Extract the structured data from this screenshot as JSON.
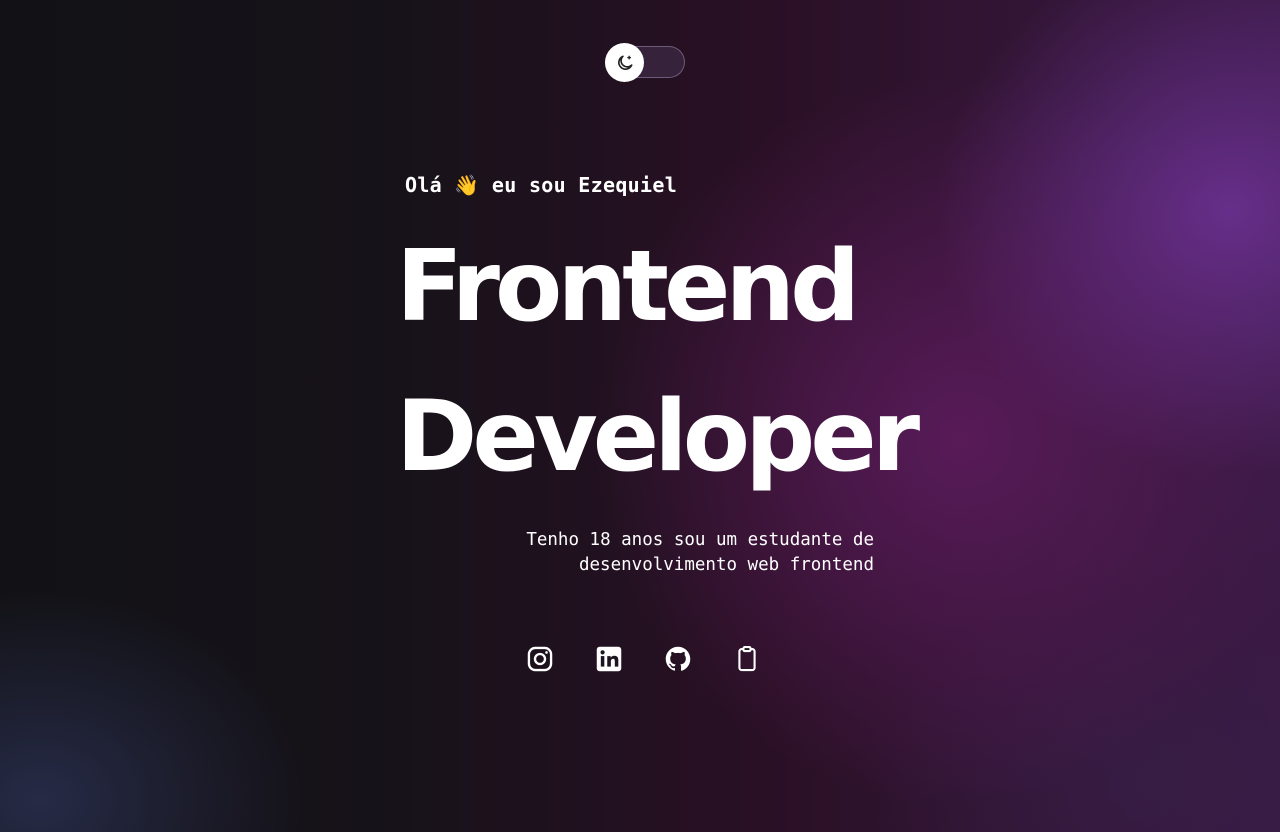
{
  "theme_toggle": {
    "icon": "moon-icon",
    "state": "dark"
  },
  "hero": {
    "greeting_prefix": "Olá",
    "greeting_emoji": "👋",
    "greeting_suffix": "eu sou Ezequiel",
    "title_line1": "Frontend",
    "title_line2": "Developer",
    "bio_line1": "Tenho 18 anos sou um estudante de",
    "bio_line2": "desenvolvimento web frontend"
  },
  "socials": [
    {
      "icon": "instagram-icon"
    },
    {
      "icon": "linkedin-icon"
    },
    {
      "icon": "github-icon"
    },
    {
      "icon": "clipboard-icon"
    }
  ],
  "colors": {
    "text": "#ffffff",
    "background_dark": "#131317",
    "accent_purple": "#6e3296",
    "accent_magenta": "#5f1c5f"
  }
}
